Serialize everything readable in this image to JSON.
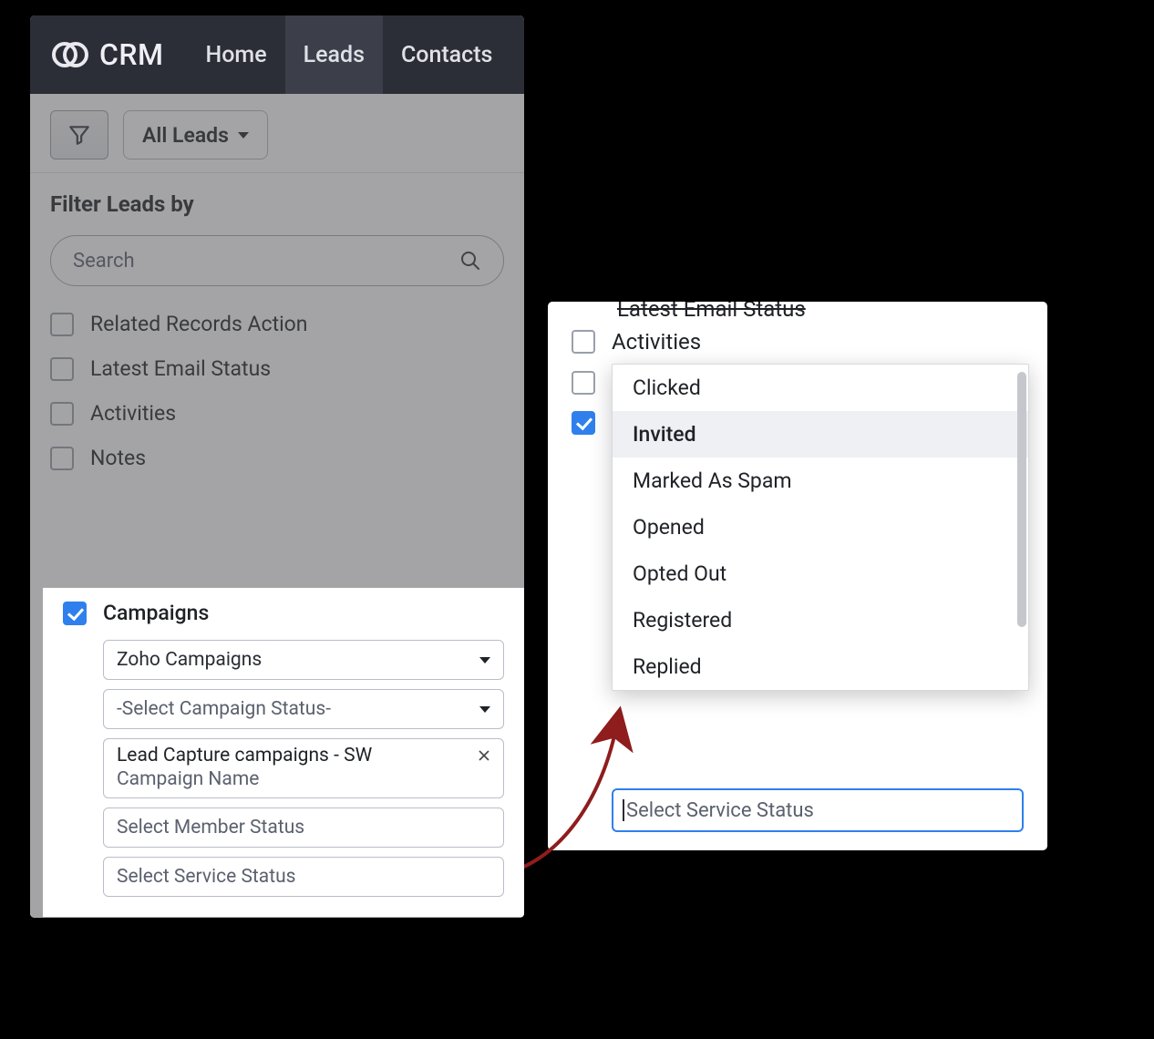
{
  "brand": "CRM",
  "nav": {
    "home": "Home",
    "leads": "Leads",
    "contacts": "Contacts"
  },
  "toolbar": {
    "all_leads": "All Leads"
  },
  "filter": {
    "title": "Filter Leads by",
    "search_placeholder": "Search",
    "items": {
      "related": "Related Records Action",
      "latest_email": "Latest Email Status",
      "activities": "Activities",
      "notes": "Notes",
      "campaigns": "Campaigns"
    }
  },
  "campaigns_panel": {
    "source_value": "Zoho Campaigns",
    "campaign_status_placeholder": "-Select Campaign Status-",
    "tag_value": "Lead Capture campaigns - SW",
    "tag_sub_placeholder": "Campaign Name",
    "member_status_placeholder": "Select Member Status",
    "service_status_placeholder": "Select Service Status"
  },
  "right_panel": {
    "cut_title": "Latest Email Status",
    "activities_label": "Activities",
    "dropdown_options": [
      "Clicked",
      "Invited",
      "Marked As Spam",
      "Opened",
      "Opted Out",
      "Registered",
      "Replied"
    ],
    "dropdown_highlight_index": 1,
    "service_status_placeholder": "Select Service Status"
  }
}
